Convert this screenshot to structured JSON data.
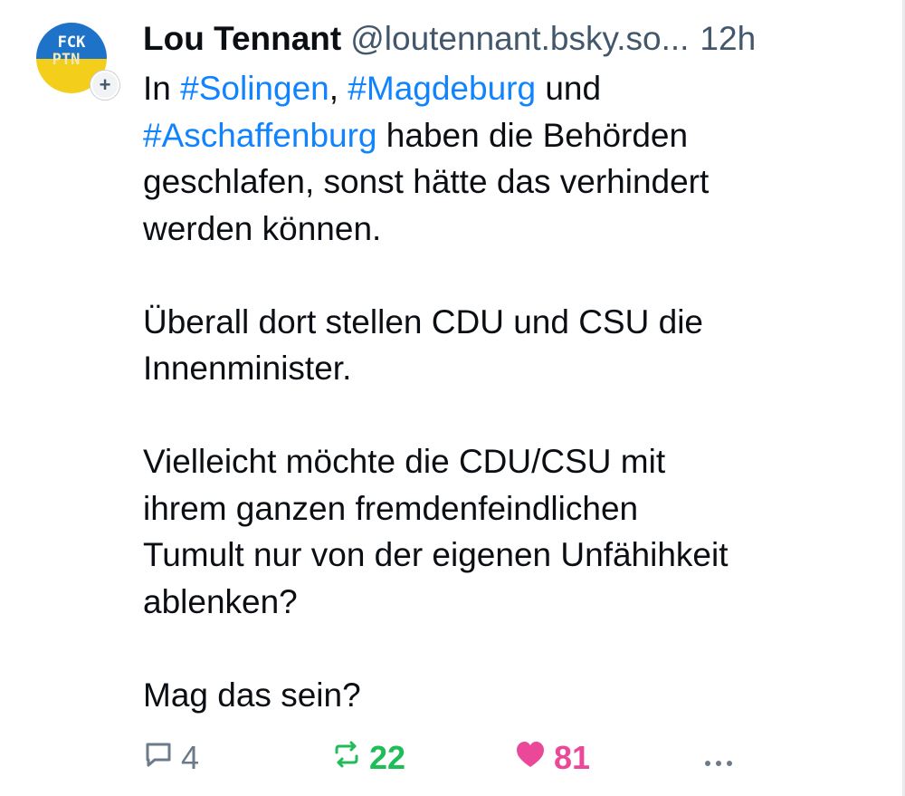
{
  "post": {
    "author": {
      "display_name": "Lou Tennant",
      "handle": "@loutennant.bsky.so...",
      "avatar_text_line1": "FCK",
      "avatar_text_line2": "PTN",
      "follow_badge": "+"
    },
    "timestamp": "12h",
    "text": {
      "p1_tag1": "#Solingen",
      "p1_sep1": ", ",
      "p1_tag2": "#Magdeburg",
      "p1_in": "In ",
      "p1_und": " und",
      "p1_tag3": "#Aschaffenburg",
      "p1_rest1": " haben die Behörden",
      "p1_line3": "geschlafen, sonst hätte das verhindert",
      "p1_line4": "werden können.",
      "p2_line1": "Überall dort stellen CDU und CSU die",
      "p2_line2": "Innenminister.",
      "p3_line1": "Vielleicht möchte die CDU/CSU mit",
      "p3_line2": "ihrem ganzen fremdenfeindlichen",
      "p3_line3": "Tumult nur von der eigenen Unfähihkeit",
      "p3_line4": "ablenken?",
      "p4_line1": "Mag das sein?"
    },
    "actions": {
      "reply_count": "4",
      "repost_count": "22",
      "like_count": "81",
      "more_label": "•••"
    },
    "icons": {
      "reply": "reply-bubble-icon",
      "repost": "repost-arrows-icon",
      "like": "heart-icon",
      "more": "ellipsis-icon"
    },
    "colors": {
      "hashtag": "#1083fe",
      "muted": "#42576c",
      "repost_active": "#20bc5a",
      "like_active": "#ec4899",
      "avatar_blue": "#1e73c8",
      "avatar_yellow": "#f3cf1c"
    }
  }
}
